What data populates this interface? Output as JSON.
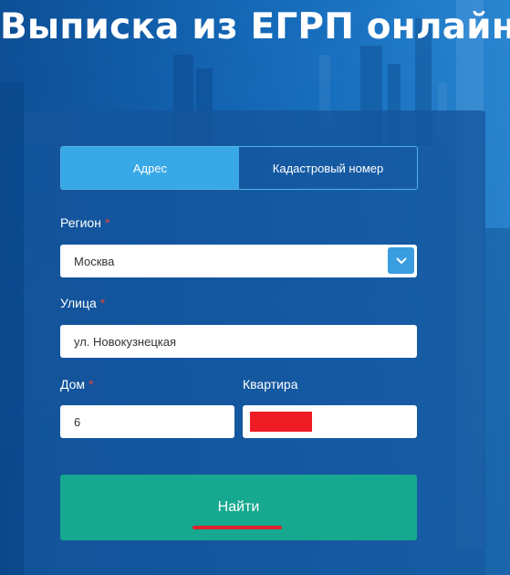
{
  "page": {
    "title": "Выписка из ЕГРП онлайн"
  },
  "tabs": [
    {
      "label": "Адрес",
      "active": true
    },
    {
      "label": "Кадастровый номер",
      "active": false
    }
  ],
  "form": {
    "region": {
      "label": "Регион",
      "required_mark": "*",
      "value": "Москва"
    },
    "street": {
      "label": "Улица",
      "required_mark": "*",
      "value": "ул. Новокузнецкая"
    },
    "house": {
      "label": "Дом",
      "required_mark": "*",
      "value": "6"
    },
    "apartment": {
      "label": "Квартира",
      "value_redacted": true
    }
  },
  "submit": {
    "label": "Найти"
  },
  "colors": {
    "tab_active": "#38a8e6",
    "submit_button": "#16a98f",
    "required_mark": "#e6443b",
    "redaction": "#ee1c24",
    "select_arrow_bg": "#3a9de0"
  },
  "icons": {
    "select_arrow": "chevron-down-icon"
  }
}
